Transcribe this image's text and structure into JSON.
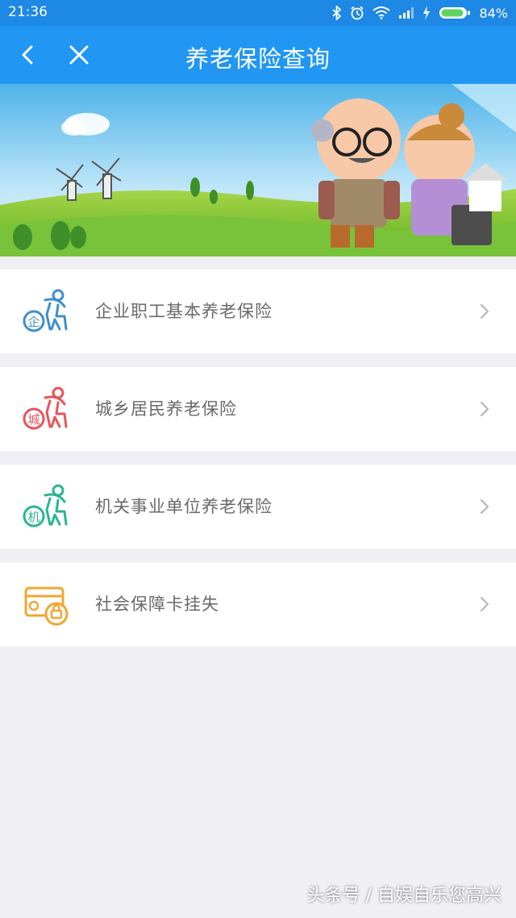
{
  "status_bar": {
    "time": "21:36",
    "battery": "84%"
  },
  "header": {
    "title": "养老保险查询",
    "back_icon": "chevron-left-icon",
    "close_icon": "close-icon"
  },
  "banner": {
    "description_icon": "elderly-couple-banner"
  },
  "menu": {
    "items": [
      {
        "label": "企业职工基本养老保险",
        "badge": "企",
        "color": "#3f8fd2",
        "icon": "enterprise-pension-icon"
      },
      {
        "label": "城乡居民养老保险",
        "badge": "城",
        "color": "#e8555a",
        "icon": "resident-pension-icon"
      },
      {
        "label": "机关事业单位养老保险",
        "badge": "机",
        "color": "#2bb592",
        "icon": "institution-pension-icon"
      },
      {
        "label": "社会保障卡挂失",
        "color": "#f2a634",
        "icon": "social-security-card-icon"
      }
    ]
  },
  "watermark": "头条号 / 自娱自乐您高兴"
}
